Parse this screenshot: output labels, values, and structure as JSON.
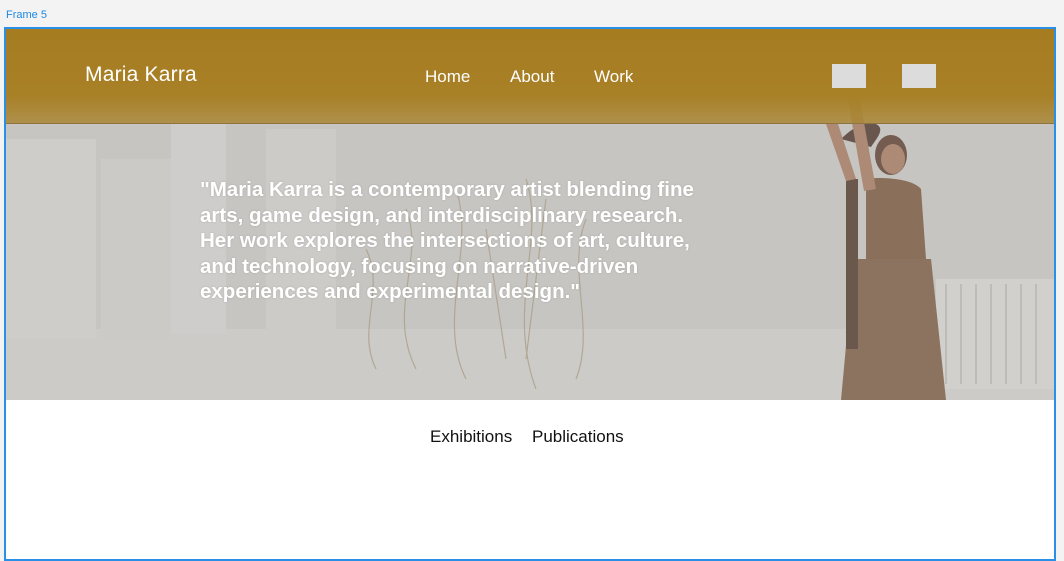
{
  "frame": {
    "label": "Frame 5"
  },
  "header": {
    "brand": "Maria Karra",
    "nav": [
      {
        "label": "Home"
      },
      {
        "label": "About"
      },
      {
        "label": "Work"
      }
    ],
    "accent_color": "#a67c20"
  },
  "hero": {
    "quote": "\"Maria Karra is a contemporary artist blending fine arts, game design, and interdisciplinary research. Her work explores the intersections of art, culture, and technology, focusing on narrative-driven experiences and experimental design.\""
  },
  "tabs": [
    {
      "label": "Exhibitions"
    },
    {
      "label": "Publications"
    }
  ]
}
